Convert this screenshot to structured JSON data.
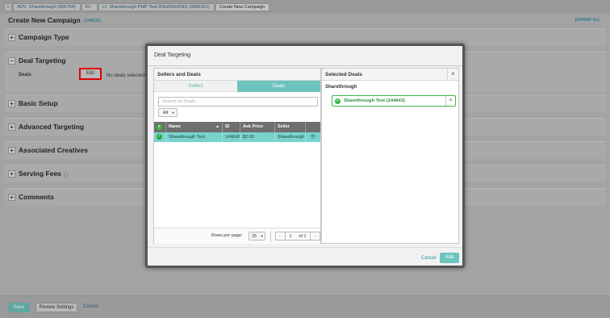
{
  "breadcrumb": {
    "home_icon": "home-icon",
    "items": [
      {
        "prefix": "ADV:",
        "label": "Sharethrough (906764)"
      },
      {
        "prefix": "IO:",
        "label": ""
      },
      {
        "prefix": "LI:",
        "label": "Sharethrough PMP Test DNUDNUDNU (2860301)"
      },
      {
        "prefix": "",
        "label": "Create New Campaign"
      }
    ]
  },
  "page": {
    "title": "Create New Campaign",
    "cancel_link": "CANCEL",
    "expand_all": "EXPAND ALL"
  },
  "sections": [
    {
      "title": "Campaign Type",
      "toggle": "+"
    },
    {
      "title": "Deal Targeting",
      "toggle": "−",
      "deals_label": "Deals",
      "edit_button": "Edit",
      "deals_status": "No deals selected"
    },
    {
      "title": "Basic Setup",
      "toggle": "+"
    },
    {
      "title": "Advanced Targeting",
      "toggle": "+"
    },
    {
      "title": "Associated Creatives",
      "toggle": "+"
    },
    {
      "title": "Serving Fees",
      "toggle": "+"
    },
    {
      "title": "Comments",
      "toggle": "+"
    }
  ],
  "footer": {
    "save": "Save",
    "review": "Review Settings",
    "cancel": "Cancel"
  },
  "modal": {
    "title": "Deal Targeting",
    "left_panel": {
      "title": "Sellers and Deals",
      "tabs": [
        {
          "label": "Sellers",
          "active": false
        },
        {
          "label": "Deals",
          "active": true
        }
      ],
      "search_placeholder": "Search for Deals...",
      "filter_value": "All",
      "columns": [
        "Name",
        "ID",
        "Ask Price",
        "Seller"
      ],
      "rows": [
        {
          "name": "Sharethrough Test",
          "id": "144643",
          "ask_price": "$2.00",
          "seller": "Sharethrough",
          "selected": true
        }
      ],
      "pagination": {
        "rows_per_page_label": "Rows per page:",
        "rows_per_page": "25",
        "page": "1",
        "of_label": "of 1"
      }
    },
    "right_panel": {
      "title": "Selected Deals",
      "group": "Sharethrough",
      "chips": [
        {
          "label": "Sharethrough Test (144643)"
        }
      ]
    },
    "cancel": "Cancel",
    "add": "Add"
  },
  "colors": {
    "accent_teal": "#6bc4bd",
    "selected_row": "#78d3cc",
    "success_green": "#3cb54a",
    "highlight_red": "#dd0000"
  }
}
